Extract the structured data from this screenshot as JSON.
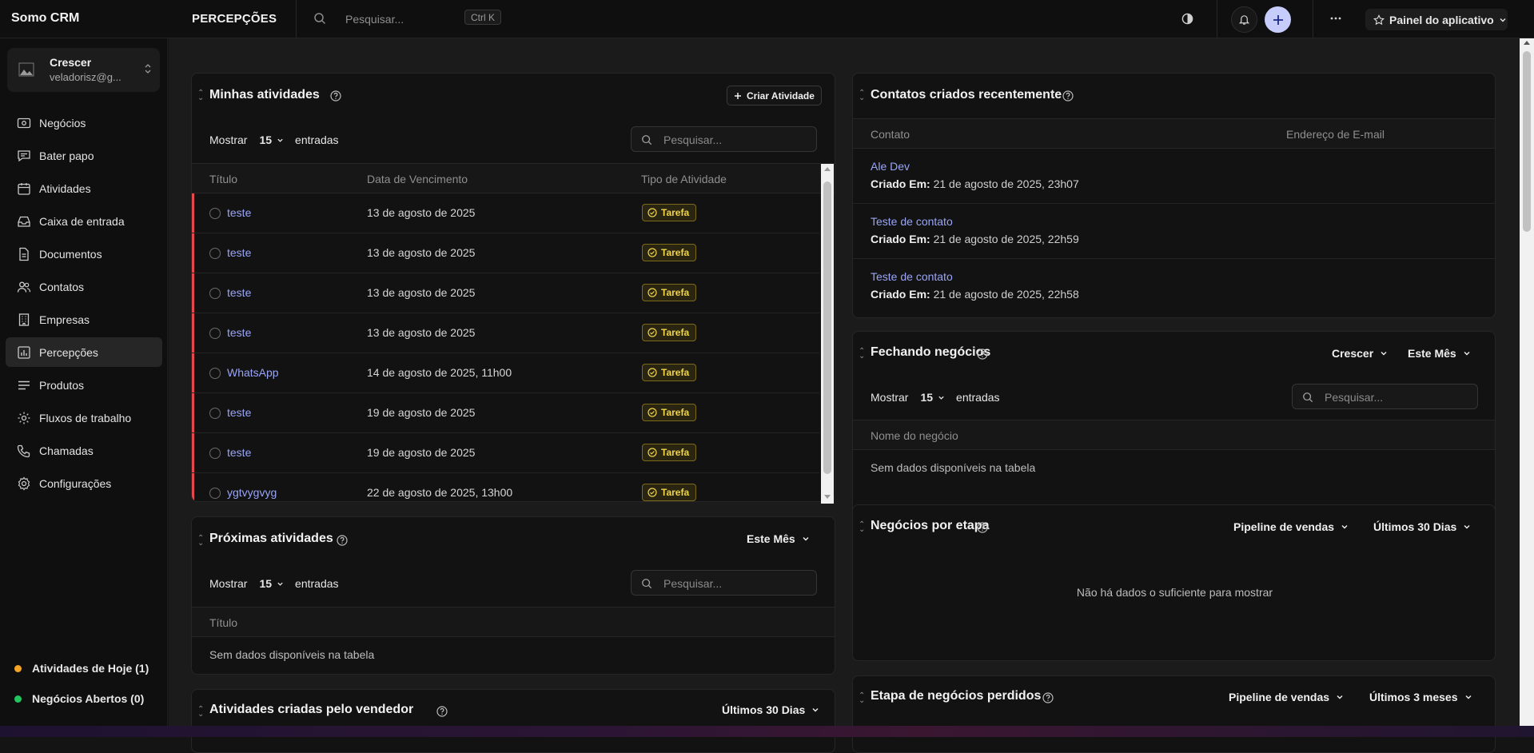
{
  "app": {
    "brand": "Somo CRM",
    "page_title": "PERCEPÇÕES"
  },
  "topbar": {
    "search_placeholder": "Pesquisar...",
    "shortcut": "Ctrl K",
    "app_panel_label": "Painel do aplicativo"
  },
  "account": {
    "name": "Crescer",
    "email": "veladorisz@g..."
  },
  "sidebar": {
    "items": [
      {
        "label": "Negócios",
        "icon": "deals-icon"
      },
      {
        "label": "Bater papo",
        "icon": "chat-icon"
      },
      {
        "label": "Atividades",
        "icon": "calendar-icon"
      },
      {
        "label": "Caixa de entrada",
        "icon": "inbox-icon"
      },
      {
        "label": "Documentos",
        "icon": "document-icon"
      },
      {
        "label": "Contatos",
        "icon": "users-icon"
      },
      {
        "label": "Empresas",
        "icon": "building-icon"
      },
      {
        "label": "Percepções",
        "icon": "chart-icon"
      },
      {
        "label": "Produtos",
        "icon": "list-icon"
      },
      {
        "label": "Fluxos de trabalho",
        "icon": "gear-icon"
      },
      {
        "label": "Chamadas",
        "icon": "phone-icon"
      },
      {
        "label": "Configurações",
        "icon": "settings-icon"
      }
    ],
    "footer": [
      {
        "label": "Atividades de Hoje (1)",
        "color": "#f5a524"
      },
      {
        "label": "Negócios Abertos (0)",
        "color": "#22c55e"
      }
    ]
  },
  "my_activities": {
    "title": "Minhas atividades",
    "create_button": "Criar Atividade",
    "show_label": "Mostrar",
    "page_size": "15",
    "entries_label": "entradas",
    "search_placeholder": "Pesquisar...",
    "columns": [
      "Título",
      "Data de Vencimento",
      "Tipo de Atividade"
    ],
    "rows": [
      {
        "title": "teste",
        "due": "13 de agosto de 2025",
        "type": "Tarefa"
      },
      {
        "title": "teste",
        "due": "13 de agosto de 2025",
        "type": "Tarefa"
      },
      {
        "title": "teste",
        "due": "13 de agosto de 2025",
        "type": "Tarefa"
      },
      {
        "title": "teste",
        "due": "13 de agosto de 2025",
        "type": "Tarefa"
      },
      {
        "title": "WhatsApp",
        "due": "14 de agosto de 2025, 11h00",
        "type": "Tarefa"
      },
      {
        "title": "teste",
        "due": "19 de agosto de 2025",
        "type": "Tarefa"
      },
      {
        "title": "teste",
        "due": "19 de agosto de 2025",
        "type": "Tarefa"
      },
      {
        "title": "ygtvygvyg",
        "due": "22 de agosto de 2025, 13h00",
        "type": "Tarefa"
      }
    ]
  },
  "upcoming": {
    "title": "Próximas atividades",
    "period": "Este Mês",
    "show_label": "Mostrar",
    "page_size": "15",
    "entries_label": "entradas",
    "search_placeholder": "Pesquisar...",
    "column": "Título",
    "empty": "Sem dados disponíveis na tabela"
  },
  "by_seller": {
    "title": "Atividades criadas pelo vendedor",
    "period": "Últimos 30 Dias"
  },
  "recent_contacts": {
    "title": "Contatos criados recentemente",
    "columns": [
      "Contato",
      "Endereço de E-mail"
    ],
    "created_label": "Criado Em:",
    "rows": [
      {
        "name": "Ale Dev",
        "created": "21 de agosto de 2025, 23h07"
      },
      {
        "name": "Teste de contato",
        "created": "21 de agosto de 2025, 22h59"
      },
      {
        "name": "Teste de contato",
        "created": "21 de agosto de 2025, 22h58"
      }
    ]
  },
  "closing_deals": {
    "title": "Fechando negócios",
    "owner": "Crescer",
    "period": "Este Mês",
    "show_label": "Mostrar",
    "page_size": "15",
    "entries_label": "entradas",
    "search_placeholder": "Pesquisar...",
    "column": "Nome do negócio",
    "empty": "Sem dados disponíveis na tabela"
  },
  "deals_by_stage": {
    "title": "Negócios por etapa",
    "pipeline": "Pipeline de vendas",
    "period": "Últimos 30 Dias",
    "empty": "Não há dados o suficiente para mostrar"
  },
  "lost_stage": {
    "title": "Etapa de negócios perdidos",
    "pipeline": "Pipeline de vendas",
    "period": "Últimos 3 meses"
  }
}
